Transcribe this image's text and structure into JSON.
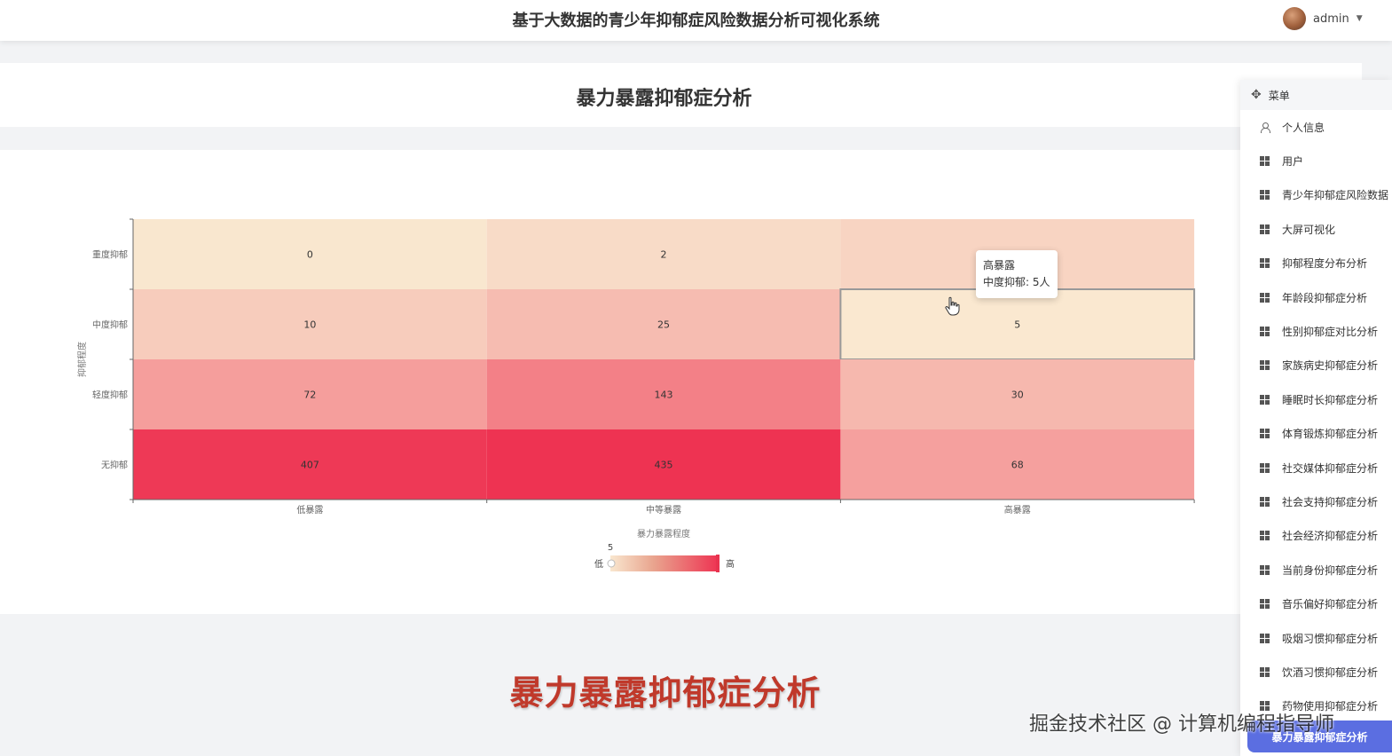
{
  "header": {
    "title": "基于大数据的青少年抑郁症风险数据分析可视化系统",
    "user": "admin"
  },
  "page": {
    "title": "暴力暴露抑郁症分析",
    "banner": "暴力暴露抑郁症分析"
  },
  "chart_data": {
    "type": "heatmap",
    "x_categories": [
      "低暴露",
      "中等暴露",
      "高暴露"
    ],
    "y_categories": [
      "重度抑郁",
      "中度抑郁",
      "轻度抑郁",
      "无抑郁"
    ],
    "values": [
      [
        0,
        2,
        5
      ],
      [
        10,
        25,
        5
      ],
      [
        72,
        143,
        30
      ],
      [
        407,
        435,
        68
      ]
    ],
    "xlabel": "暴力暴露程度",
    "ylabel": "抑郁程度",
    "visual_map": {
      "min_label": "低",
      "max_label": "高",
      "min_value": 5,
      "color_low": "#f9e7cf",
      "color_high": "#ee3352"
    },
    "highlighted_cell": {
      "x": "高暴露",
      "y": "中度抑郁"
    }
  },
  "tooltip": {
    "line1": "高暴露",
    "line2": "中度抑郁: 5人"
  },
  "menu": {
    "header": "菜单",
    "items": [
      {
        "label": "个人信息",
        "icon": "person-icon"
      },
      {
        "label": "用户",
        "icon": "grid-icon"
      },
      {
        "label": "青少年抑郁症风险数据",
        "icon": "grid-icon"
      },
      {
        "label": "大屏可视化",
        "icon": "grid-icon"
      },
      {
        "label": "抑郁程度分布分析",
        "icon": "grid-icon"
      },
      {
        "label": "年龄段抑郁症分析",
        "icon": "grid-icon"
      },
      {
        "label": "性别抑郁症对比分析",
        "icon": "grid-icon"
      },
      {
        "label": "家族病史抑郁症分析",
        "icon": "grid-icon"
      },
      {
        "label": "睡眠时长抑郁症分析",
        "icon": "grid-icon"
      },
      {
        "label": "体育锻炼抑郁症分析",
        "icon": "grid-icon"
      },
      {
        "label": "社交媒体抑郁症分析",
        "icon": "grid-icon"
      },
      {
        "label": "社会支持抑郁症分析",
        "icon": "grid-icon"
      },
      {
        "label": "社会经济抑郁症分析",
        "icon": "grid-icon"
      },
      {
        "label": "当前身份抑郁症分析",
        "icon": "grid-icon"
      },
      {
        "label": "音乐偏好抑郁症分析",
        "icon": "grid-icon"
      },
      {
        "label": "吸烟习惯抑郁症分析",
        "icon": "grid-icon"
      },
      {
        "label": "饮酒习惯抑郁症分析",
        "icon": "grid-icon"
      },
      {
        "label": "药物使用抑郁症分析",
        "icon": "grid-icon"
      }
    ],
    "bottom_active": "暴力暴露抑郁症分析"
  },
  "watermark": "掘金技术社区 @ 计算机编程指导师"
}
